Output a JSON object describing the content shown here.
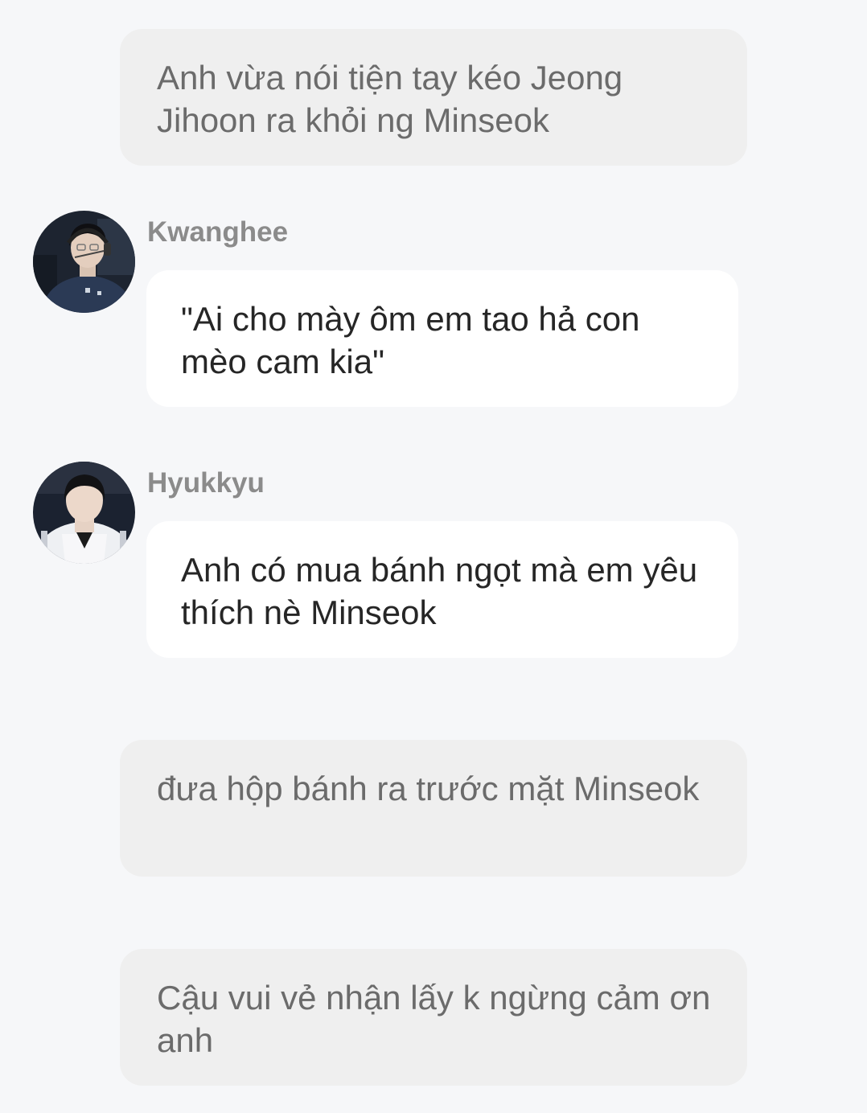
{
  "messages": {
    "narration_1": "Anh vừa nói tiện tay kéo Jeong Jihoon ra khỏi ng Minseok",
    "kwanghee": {
      "name": "Kwanghee",
      "text": "\"Ai cho mày ôm em tao hả con mèo cam kia\""
    },
    "hyukkyu": {
      "name": "Hyukkyu",
      "text": "Anh có mua bánh ngọt mà em yêu thích nè Minseok"
    },
    "narration_2": "đưa hộp bánh ra trước mặt Minseok",
    "narration_3": "Cậu vui vẻ nhận lấy k ngừng cảm ơn anh"
  },
  "colors": {
    "background": "#f6f7f9",
    "narration_bubble": "#efefef",
    "narration_text": "#6b6b6b",
    "speech_bubble": "#ffffff",
    "speech_text": "#262626",
    "speaker_name": "#8b8b8b"
  }
}
